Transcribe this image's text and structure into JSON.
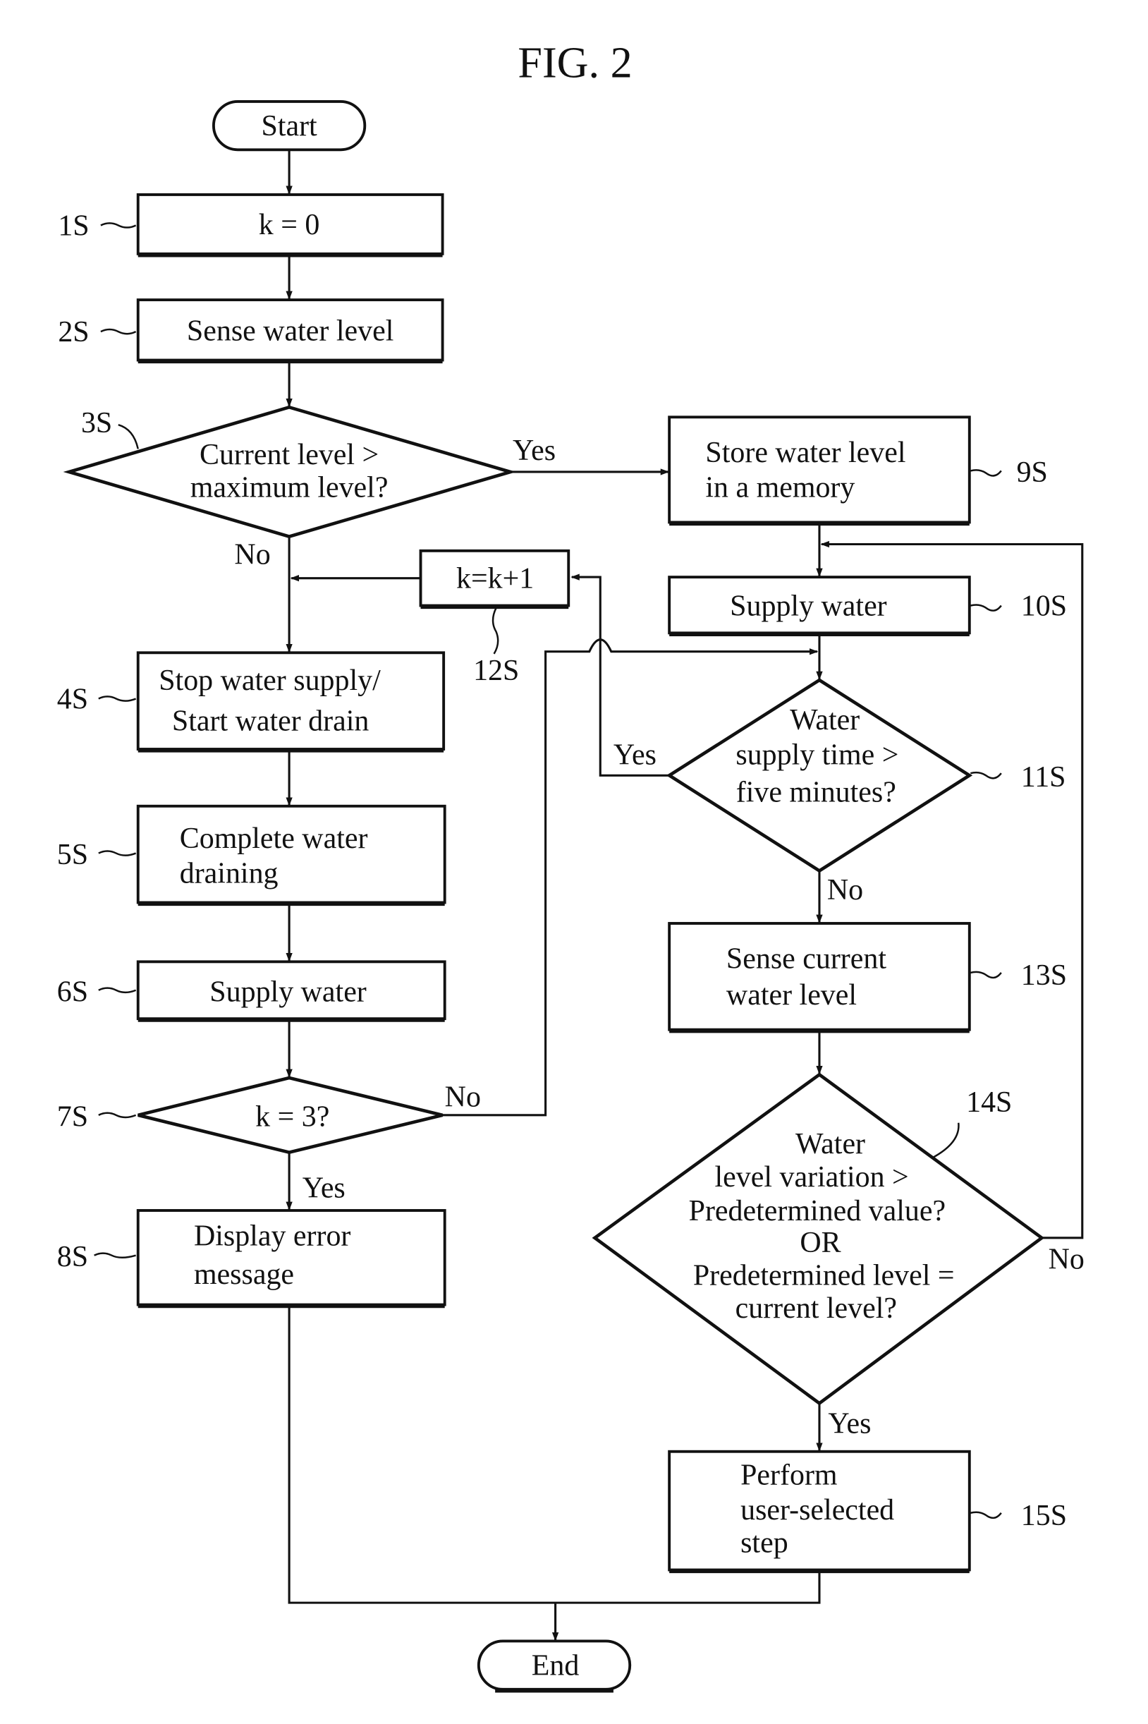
{
  "figure": {
    "title": "FIG. 2"
  },
  "nodes": {
    "start": {
      "label": "Start"
    },
    "s1": {
      "ref": "1S",
      "lines": [
        "k = 0"
      ]
    },
    "s2": {
      "ref": "2S",
      "lines": [
        "Sense water level"
      ]
    },
    "s3": {
      "ref": "3S",
      "lines": [
        "Current level >",
        "maximum level?"
      ]
    },
    "s4": {
      "ref": "4S",
      "lines": [
        "Stop water supply/",
        "Start water drain"
      ]
    },
    "s5": {
      "ref": "5S",
      "lines": [
        "Complete water",
        "draining"
      ]
    },
    "s6": {
      "ref": "6S",
      "lines": [
        "Supply water"
      ]
    },
    "s7": {
      "ref": "7S",
      "lines": [
        "k = 3?"
      ]
    },
    "s8": {
      "ref": "8S",
      "lines": [
        "Display error",
        "message"
      ]
    },
    "s9": {
      "ref": "9S",
      "lines": [
        "Store water level",
        "in a memory"
      ]
    },
    "s10": {
      "ref": "10S",
      "lines": [
        "Supply water"
      ]
    },
    "s11": {
      "ref": "11S",
      "lines": [
        "Water",
        "supply time >",
        "five minutes?"
      ]
    },
    "s12": {
      "ref": "12S",
      "lines": [
        "k=k+1"
      ]
    },
    "s13": {
      "ref": "13S",
      "lines": [
        "Sense current",
        "water level"
      ]
    },
    "s14": {
      "ref": "14S",
      "lines": [
        "Water",
        "level variation >",
        "Predetermined value?",
        "OR",
        "Predetermined level =",
        "current level?"
      ]
    },
    "s15": {
      "ref": "15S",
      "lines": [
        "Perform",
        "user-selected",
        "step"
      ]
    },
    "end": {
      "label": "End"
    }
  },
  "branches": {
    "s3_yes": "Yes",
    "s3_no": "No",
    "s7_yes": "Yes",
    "s7_no": "No",
    "s11_yes": "Yes",
    "s11_no": "No",
    "s14_yes": "Yes",
    "s14_no": "No"
  }
}
